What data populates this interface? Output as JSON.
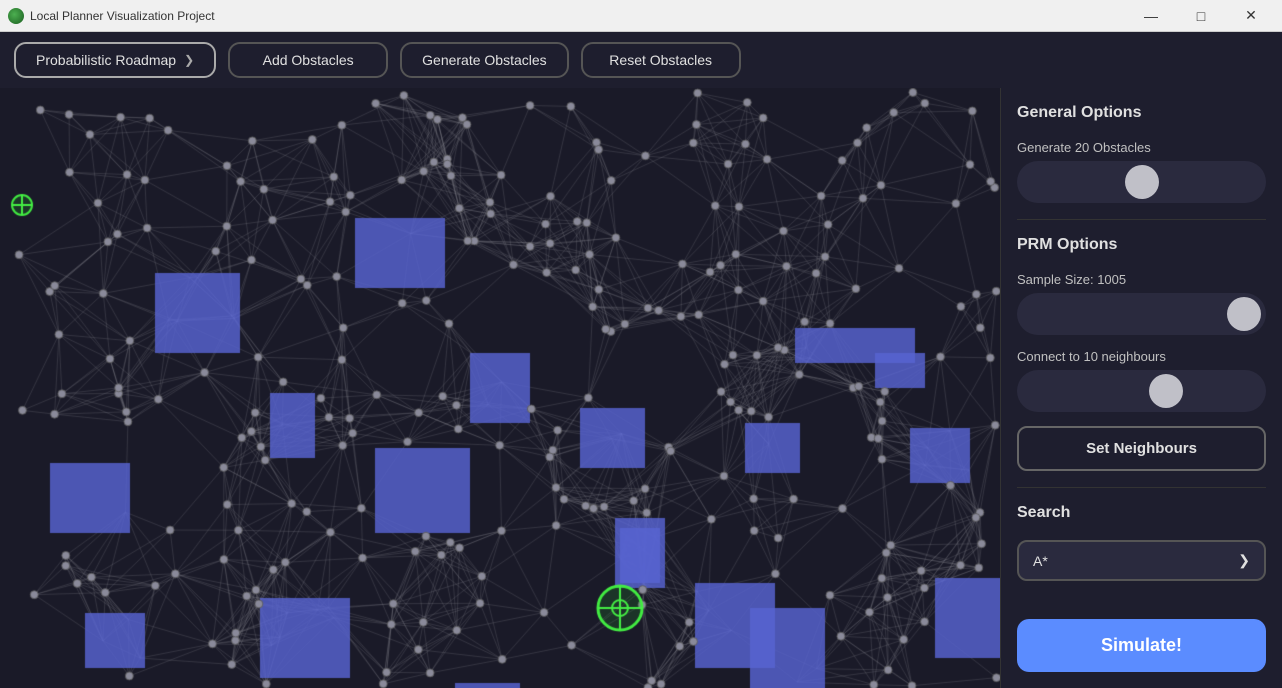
{
  "titlebar": {
    "title": "Local Planner Visualization Project",
    "icon": "globe-icon",
    "minimize_label": "—",
    "maximize_label": "□",
    "close_label": "✕"
  },
  "toolbar": {
    "algorithm_btn": "Probabilistic Roadmap",
    "algorithm_arrow": "❯",
    "add_obstacles_btn": "Add Obstacles",
    "generate_obstacles_btn": "Generate Obstacles",
    "reset_obstacles_btn": "Reset Obstacles"
  },
  "sidebar": {
    "general_options_title": "General Options",
    "generate_obstacles_label": "Generate 20 Obstacles",
    "prm_options_title": "PRM Options",
    "sample_size_label": "Sample Size: 1005",
    "connect_neighbours_label": "Connect to 10 neighbours",
    "set_neighbours_btn": "Set Neighbours",
    "search_title": "Search",
    "search_value": "A*",
    "search_arrow": "❯",
    "simulate_btn": "Simulate!"
  },
  "canvas": {
    "background_color": "#1a1a28",
    "node_color": "#888",
    "edge_color": "#555",
    "obstacle_color": "#5566cc",
    "agent_color": "#44ee44",
    "target_color": "#44ee44"
  }
}
